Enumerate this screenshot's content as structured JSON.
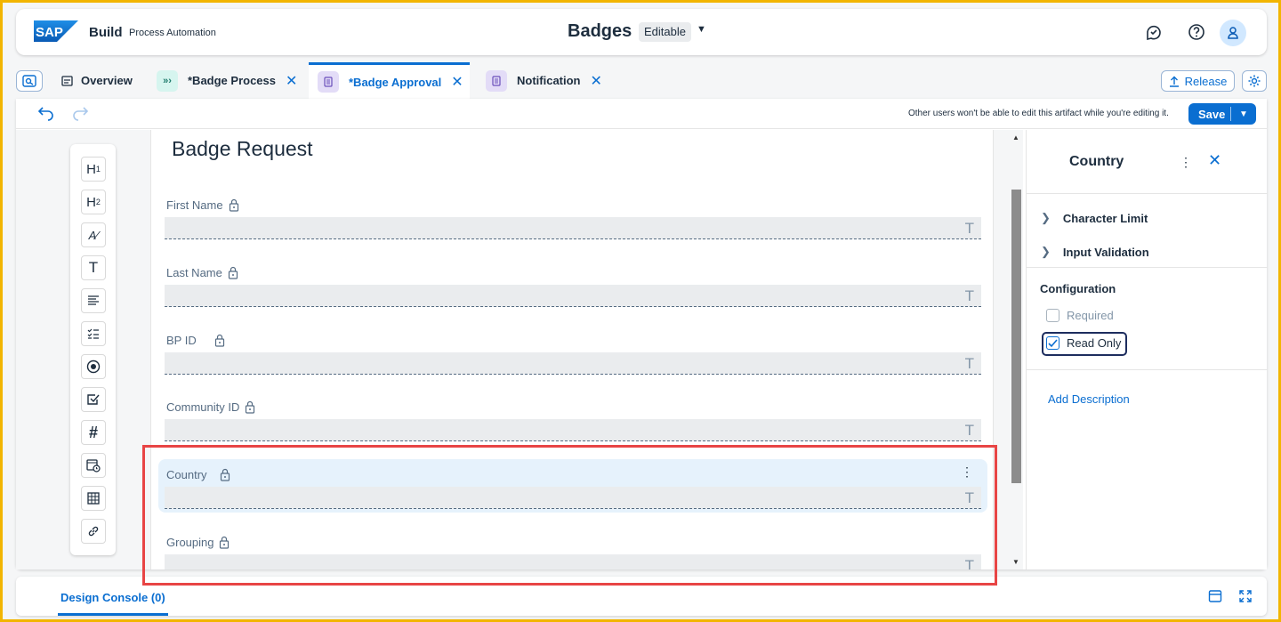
{
  "shell": {
    "logo_text": "SAP",
    "brand": "Build",
    "product": "Process Automation",
    "title": "Badges",
    "status": "Editable"
  },
  "tabs": [
    {
      "label": "Overview",
      "active": false
    },
    {
      "label": "*Badge Process",
      "active": false
    },
    {
      "label": "*Badge Approval",
      "active": true
    },
    {
      "label": "Notification",
      "active": false
    }
  ],
  "tabbar": {
    "release_label": "Release"
  },
  "toolbar": {
    "notice": "Other users won't be able to edit this artifact while you're editing it.",
    "save_label": "Save"
  },
  "palette": {
    "items": [
      "H1",
      "H2",
      "text-style",
      "T",
      "paragraph",
      "checklist",
      "radio",
      "checkbox",
      "#",
      "date",
      "table",
      "link"
    ]
  },
  "form": {
    "title": "Badge Request",
    "fields": [
      {
        "label": "First Name"
      },
      {
        "label": "Last Name"
      },
      {
        "label": "BP ID"
      },
      {
        "label": "Community ID"
      },
      {
        "label": "Country"
      },
      {
        "label": "Grouping"
      }
    ],
    "field_type_glyph": "T"
  },
  "panel": {
    "title": "Country",
    "accordions": [
      "Character Limit",
      "Input Validation"
    ],
    "section": "Configuration",
    "required_label": "Required",
    "required_checked": false,
    "readonly_label": "Read Only",
    "readonly_checked": true,
    "add_description": "Add Description"
  },
  "console": {
    "tab_label": "Design Console (0)"
  },
  "colors": {
    "accent": "#0a6ed1",
    "highlight": "#e84545",
    "frame": "#f2b500"
  }
}
